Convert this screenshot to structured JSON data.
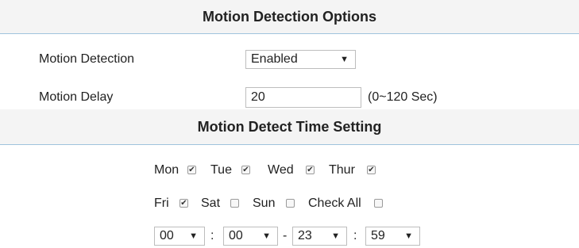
{
  "sections": {
    "motion_options_title": "Motion Detection Options",
    "time_setting_title": "Motion Detect Time Setting"
  },
  "motion_detection": {
    "label": "Motion Detection",
    "value": "Enabled"
  },
  "motion_delay": {
    "label": "Motion Delay",
    "value": "20",
    "hint": "(0~120 Sec)"
  },
  "days": [
    {
      "label": "Mon",
      "checked": true
    },
    {
      "label": "Tue",
      "checked": true
    },
    {
      "label": "Wed",
      "checked": true
    },
    {
      "label": "Thur",
      "checked": true
    },
    {
      "label": "Fri",
      "checked": true
    },
    {
      "label": "Sat",
      "checked": false
    },
    {
      "label": "Sun",
      "checked": false
    },
    {
      "label": "Check All",
      "checked": false
    }
  ],
  "time_range": {
    "start_hour": "00",
    "start_minute": "00",
    "end_hour": "23",
    "end_minute": "59",
    "colon": ":",
    "dash": "-"
  },
  "icons": {
    "dropdown": "dropdown-arrow-icon",
    "checkbox_check": "✔"
  }
}
